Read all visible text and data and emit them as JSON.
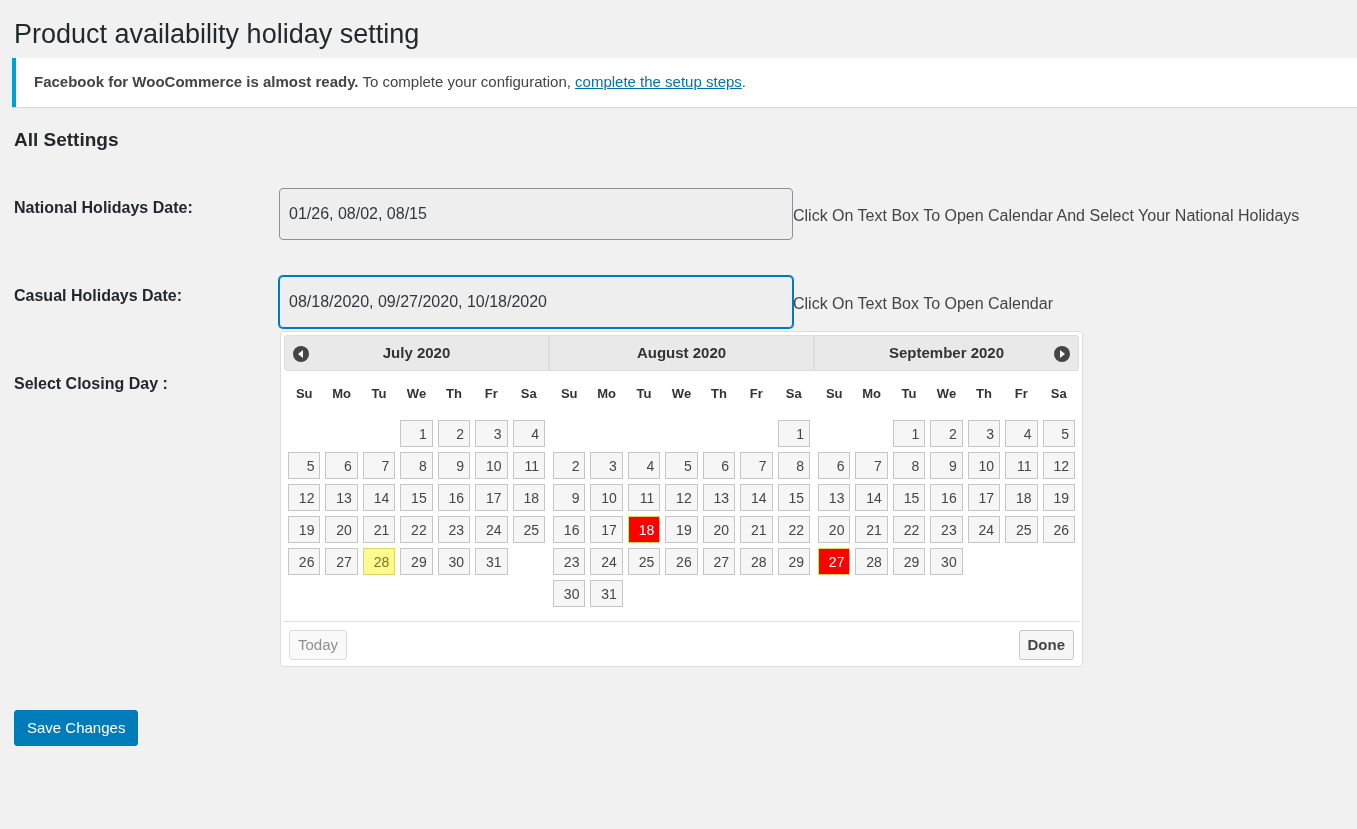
{
  "page_title": "Product availability holiday setting",
  "notice": {
    "text": "**Facebook for WooCommerce is almost ready.** To complete your configuration, ",
    "link": "complete the setup steps",
    "after": "."
  },
  "section_title": "All Settings",
  "fields": [
    {
      "label": "National Holidays Date:",
      "value": "01/26, 08/02, 08/15",
      "hint": "Click On Text Box To Open Calendar And Select Your National Holidays",
      "focused": false
    },
    {
      "label": "Casual Holidays Date:",
      "value": "08/18/2020, 09/27/2020, 10/18/2020",
      "hint": "Click On Text Box To Open Calendar",
      "focused": true
    },
    {
      "label": "Select Closing Day :"
    }
  ],
  "datepicker": {
    "months": [
      {
        "title": "July 2020",
        "weekdays": [
          "Su",
          "Mo",
          "Tu",
          "We",
          "Th",
          "Fr",
          "Sa"
        ],
        "weeks": [
          [
            {
              "kind": "blank"
            },
            {
              "kind": "blank"
            },
            {
              "kind": "blank"
            },
            {
              "kind": "day",
              "d": "1",
              "selected": false,
              "today": false
            },
            {
              "kind": "day",
              "d": "2",
              "selected": false,
              "today": false
            },
            {
              "kind": "day",
              "d": "3",
              "selected": false,
              "today": false
            },
            {
              "kind": "day",
              "d": "4",
              "selected": false,
              "today": false
            }
          ],
          [
            {
              "kind": "day",
              "d": "5",
              "selected": false,
              "today": false
            },
            {
              "kind": "day",
              "d": "6",
              "selected": false,
              "today": false
            },
            {
              "kind": "day",
              "d": "7",
              "selected": false,
              "today": false
            },
            {
              "kind": "day",
              "d": "8",
              "selected": false,
              "today": false
            },
            {
              "kind": "day",
              "d": "9",
              "selected": false,
              "today": false
            },
            {
              "kind": "day",
              "d": "10",
              "selected": false,
              "today": false
            },
            {
              "kind": "day",
              "d": "11",
              "selected": false,
              "today": false
            }
          ],
          [
            {
              "kind": "day",
              "d": "12",
              "selected": false,
              "today": false
            },
            {
              "kind": "day",
              "d": "13",
              "selected": false,
              "today": false
            },
            {
              "kind": "day",
              "d": "14",
              "selected": false,
              "today": false
            },
            {
              "kind": "day",
              "d": "15",
              "selected": false,
              "today": false
            },
            {
              "kind": "day",
              "d": "16",
              "selected": false,
              "today": false
            },
            {
              "kind": "day",
              "d": "17",
              "selected": false,
              "today": false
            },
            {
              "kind": "day",
              "d": "18",
              "selected": false,
              "today": false
            }
          ],
          [
            {
              "kind": "day",
              "d": "19",
              "selected": false,
              "today": false
            },
            {
              "kind": "day",
              "d": "20",
              "selected": false,
              "today": false
            },
            {
              "kind": "day",
              "d": "21",
              "selected": false,
              "today": false
            },
            {
              "kind": "day",
              "d": "22",
              "selected": false,
              "today": false
            },
            {
              "kind": "day",
              "d": "23",
              "selected": false,
              "today": false
            },
            {
              "kind": "day",
              "d": "24",
              "selected": false,
              "today": false
            },
            {
              "kind": "day",
              "d": "25",
              "selected": false,
              "today": false
            }
          ],
          [
            {
              "kind": "day",
              "d": "26",
              "selected": false,
              "today": false
            },
            {
              "kind": "day",
              "d": "27",
              "selected": false,
              "today": false
            },
            {
              "kind": "day",
              "d": "28",
              "selected": false,
              "today": true
            },
            {
              "kind": "day",
              "d": "29",
              "selected": false,
              "today": false
            },
            {
              "kind": "day",
              "d": "30",
              "selected": false,
              "today": false
            },
            {
              "kind": "day",
              "d": "31",
              "selected": false,
              "today": false
            },
            {
              "kind": "blank"
            }
          ]
        ]
      },
      {
        "title": "August 2020",
        "weekdays": [
          "Su",
          "Mo",
          "Tu",
          "We",
          "Th",
          "Fr",
          "Sa"
        ],
        "weeks": [
          [
            {
              "kind": "blank"
            },
            {
              "kind": "blank"
            },
            {
              "kind": "blank"
            },
            {
              "kind": "blank"
            },
            {
              "kind": "blank"
            },
            {
              "kind": "blank"
            },
            {
              "kind": "day",
              "d": "1",
              "selected": false,
              "today": false
            }
          ],
          [
            {
              "kind": "day",
              "d": "2",
              "selected": false,
              "today": false
            },
            {
              "kind": "day",
              "d": "3",
              "selected": false,
              "today": false
            },
            {
              "kind": "day",
              "d": "4",
              "selected": false,
              "today": false
            },
            {
              "kind": "day",
              "d": "5",
              "selected": false,
              "today": false
            },
            {
              "kind": "day",
              "d": "6",
              "selected": false,
              "today": false
            },
            {
              "kind": "day",
              "d": "7",
              "selected": false,
              "today": false
            },
            {
              "kind": "day",
              "d": "8",
              "selected": false,
              "today": false
            }
          ],
          [
            {
              "kind": "day",
              "d": "9",
              "selected": false,
              "today": false
            },
            {
              "kind": "day",
              "d": "10",
              "selected": false,
              "today": false
            },
            {
              "kind": "day",
              "d": "11",
              "selected": false,
              "today": false
            },
            {
              "kind": "day",
              "d": "12",
              "selected": false,
              "today": false
            },
            {
              "kind": "day",
              "d": "13",
              "selected": false,
              "today": false
            },
            {
              "kind": "day",
              "d": "14",
              "selected": false,
              "today": false
            },
            {
              "kind": "day",
              "d": "15",
              "selected": false,
              "today": false
            }
          ],
          [
            {
              "kind": "day",
              "d": "16",
              "selected": false,
              "today": false
            },
            {
              "kind": "day",
              "d": "17",
              "selected": false,
              "today": false
            },
            {
              "kind": "day",
              "d": "18",
              "selected": true,
              "today": false
            },
            {
              "kind": "day",
              "d": "19",
              "selected": false,
              "today": false
            },
            {
              "kind": "day",
              "d": "20",
              "selected": false,
              "today": false
            },
            {
              "kind": "day",
              "d": "21",
              "selected": false,
              "today": false
            },
            {
              "kind": "day",
              "d": "22",
              "selected": false,
              "today": false
            }
          ],
          [
            {
              "kind": "day",
              "d": "23",
              "selected": false,
              "today": false
            },
            {
              "kind": "day",
              "d": "24",
              "selected": false,
              "today": false
            },
            {
              "kind": "day",
              "d": "25",
              "selected": false,
              "today": false
            },
            {
              "kind": "day",
              "d": "26",
              "selected": false,
              "today": false
            },
            {
              "kind": "day",
              "d": "27",
              "selected": false,
              "today": false
            },
            {
              "kind": "day",
              "d": "28",
              "selected": false,
              "today": false
            },
            {
              "kind": "day",
              "d": "29",
              "selected": false,
              "today": false
            }
          ],
          [
            {
              "kind": "day",
              "d": "30",
              "selected": false,
              "today": false
            },
            {
              "kind": "day",
              "d": "31",
              "selected": false,
              "today": false
            },
            {
              "kind": "blank"
            },
            {
              "kind": "blank"
            },
            {
              "kind": "blank"
            },
            {
              "kind": "blank"
            },
            {
              "kind": "blank"
            }
          ]
        ]
      },
      {
        "title": "September 2020",
        "weekdays": [
          "Su",
          "Mo",
          "Tu",
          "We",
          "Th",
          "Fr",
          "Sa"
        ],
        "weeks": [
          [
            {
              "kind": "blank"
            },
            {
              "kind": "blank"
            },
            {
              "kind": "day",
              "d": "1",
              "selected": false,
              "today": false
            },
            {
              "kind": "day",
              "d": "2",
              "selected": false,
              "today": false
            },
            {
              "kind": "day",
              "d": "3",
              "selected": false,
              "today": false
            },
            {
              "kind": "day",
              "d": "4",
              "selected": false,
              "today": false
            },
            {
              "kind": "day",
              "d": "5",
              "selected": false,
              "today": false
            }
          ],
          [
            {
              "kind": "day",
              "d": "6",
              "selected": false,
              "today": false
            },
            {
              "kind": "day",
              "d": "7",
              "selected": false,
              "today": false
            },
            {
              "kind": "day",
              "d": "8",
              "selected": false,
              "today": false
            },
            {
              "kind": "day",
              "d": "9",
              "selected": false,
              "today": false
            },
            {
              "kind": "day",
              "d": "10",
              "selected": false,
              "today": false
            },
            {
              "kind": "day",
              "d": "11",
              "selected": false,
              "today": false
            },
            {
              "kind": "day",
              "d": "12",
              "selected": false,
              "today": false
            }
          ],
          [
            {
              "kind": "day",
              "d": "13",
              "selected": false,
              "today": false
            },
            {
              "kind": "day",
              "d": "14",
              "selected": false,
              "today": false
            },
            {
              "kind": "day",
              "d": "15",
              "selected": false,
              "today": false
            },
            {
              "kind": "day",
              "d": "16",
              "selected": false,
              "today": false
            },
            {
              "kind": "day",
              "d": "17",
              "selected": false,
              "today": false
            },
            {
              "kind": "day",
              "d": "18",
              "selected": false,
              "today": false
            },
            {
              "kind": "day",
              "d": "19",
              "selected": false,
              "today": false
            }
          ],
          [
            {
              "kind": "day",
              "d": "20",
              "selected": false,
              "today": false
            },
            {
              "kind": "day",
              "d": "21",
              "selected": false,
              "today": false
            },
            {
              "kind": "day",
              "d": "22",
              "selected": false,
              "today": false
            },
            {
              "kind": "day",
              "d": "23",
              "selected": false,
              "today": false
            },
            {
              "kind": "day",
              "d": "24",
              "selected": false,
              "today": false
            },
            {
              "kind": "day",
              "d": "25",
              "selected": false,
              "today": false
            },
            {
              "kind": "day",
              "d": "26",
              "selected": false,
              "today": false
            }
          ],
          [
            {
              "kind": "day",
              "d": "27",
              "selected": true,
              "today": false
            },
            {
              "kind": "day",
              "d": "28",
              "selected": false,
              "today": false
            },
            {
              "kind": "day",
              "d": "29",
              "selected": false,
              "today": false
            },
            {
              "kind": "day",
              "d": "30",
              "selected": false,
              "today": false
            },
            {
              "kind": "blank"
            },
            {
              "kind": "blank"
            },
            {
              "kind": "blank"
            }
          ]
        ]
      }
    ],
    "today_button": "Today",
    "done_button": "Done"
  },
  "save_button": "Save Changes"
}
